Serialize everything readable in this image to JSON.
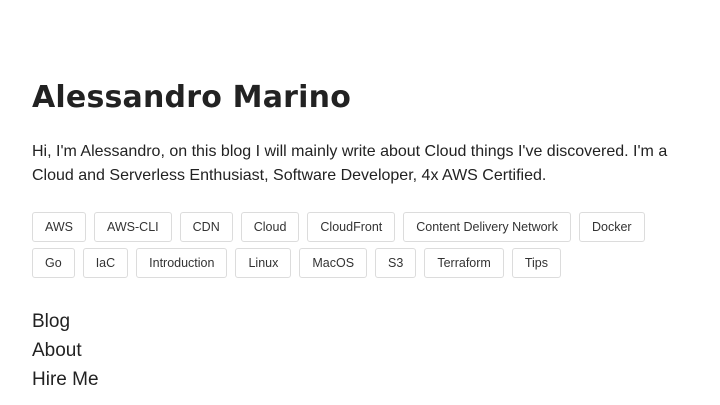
{
  "header": {
    "title": "Alessandro Marino"
  },
  "bio": {
    "text": "Hi, I'm Alessandro, on this blog I will mainly write about Cloud things I've discovered. I'm a Cloud and Serverless Enthusiast, Software Developer, 4x AWS Certified."
  },
  "tags": [
    {
      "label": "AWS"
    },
    {
      "label": "AWS-CLI"
    },
    {
      "label": "CDN"
    },
    {
      "label": "Cloud"
    },
    {
      "label": "CloudFront"
    },
    {
      "label": "Content Delivery Network"
    },
    {
      "label": "Docker"
    },
    {
      "label": "Go"
    },
    {
      "label": "IaC"
    },
    {
      "label": "Introduction"
    },
    {
      "label": "Linux"
    },
    {
      "label": "MacOS"
    },
    {
      "label": "S3"
    },
    {
      "label": "Terraform"
    },
    {
      "label": "Tips"
    }
  ],
  "nav": {
    "items": [
      {
        "label": "Blog"
      },
      {
        "label": "About"
      },
      {
        "label": "Hire Me"
      }
    ]
  },
  "colors": {
    "text": "#222222",
    "tag_border": "#dcdcdc",
    "background": "#ffffff"
  }
}
